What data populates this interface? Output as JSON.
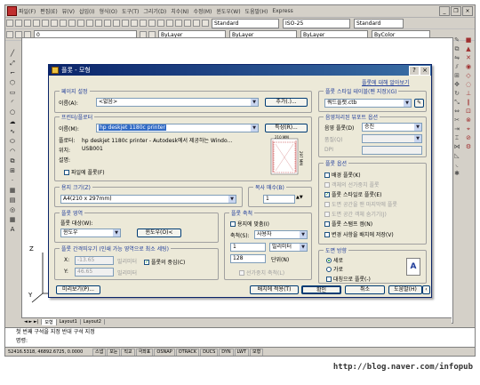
{
  "menubar": {
    "items": [
      "파일(F)",
      "편집(E)",
      "뷰(V)",
      "삽입(I)",
      "형식(O)",
      "도구(T)",
      "그리기(D)",
      "치수(N)",
      "수정(M)",
      "윈도우(W)",
      "도움말(H)",
      "Express"
    ]
  },
  "toolbar": {
    "textstyle": "Standard",
    "dimstyle": "ISO-25",
    "tablestyle": "Standard",
    "layer": "0",
    "color": "ByLayer",
    "linetype": "ByLayer",
    "lineweight": "ByLayer",
    "plotstyle": "ByColor"
  },
  "dialog": {
    "title": "플롯 - 모형",
    "help_link": "플롯에 대해 알아보기",
    "page_setup": {
      "label": "페이지 설정",
      "name_label": "이름(A):",
      "name_value": "<없음>",
      "add_button": "추가(.)..."
    },
    "printer": {
      "label": "프린터/플로터",
      "name_label": "이름(M):",
      "name_value": "hp deskjet 1180c printer",
      "properties_button": "특성(R)...",
      "plotter_label": "플로터:",
      "plotter_value": "hp deskjet 1180c printer - Autodesk에서 제공하는 Windo...",
      "where_label": "위치:",
      "where_value": "USB001",
      "desc_label": "설명:",
      "plot_to_file": "파일에 플롯(F)",
      "preview_dim_h": "210 MM",
      "preview_dim_v": "297 MM"
    },
    "paper_size": {
      "label": "용지 크기(Z)",
      "value": "A4(210 x 297mm)"
    },
    "copies": {
      "label": "복사 매수(B)",
      "value": "1"
    },
    "plot_area": {
      "label": "플롯 영역",
      "what_label": "플롯 대상(W):",
      "what_value": "윈도우",
      "window_button": "윈도우(O)<"
    },
    "plot_offset": {
      "label": "플롯 간격띄우기 (인쇄 가능 영역으로 최소 세팅)",
      "x_label": "X:",
      "x_value": "-13.65",
      "x_unit": "밀리미터",
      "y_label": "Y:",
      "y_value": "46.65",
      "y_unit": "밀리미터",
      "center": "플롯의 중심(C)"
    },
    "plot_scale": {
      "label": "플롯 축척",
      "fit": "용지에 맞춤(I)",
      "scale_label": "축척(S):",
      "scale_value": "사용자",
      "num_value": "1",
      "num_unit": "밀리미터",
      "den_value": "128",
      "den_unit": "단위(N)",
      "lineweights": "선가중치 축척(L)"
    },
    "plot_style_table": {
      "label": "플롯 스타일 테이블(펜 지정)(G)",
      "value": "쿼드플랫.ctb"
    },
    "shaded_viewport": {
      "label": "음영처리된 뷰포트 옵션",
      "shade_label": "음영 플롯(D)",
      "shade_value": "승진",
      "quality_label": "품질(Q)",
      "quality_value": "",
      "dpi_label": "DPI",
      "dpi_value": ""
    },
    "plot_options": {
      "label": "플롯 옵션",
      "items": [
        {
          "label": "배경 플롯(K)",
          "checked": false,
          "disabled": false
        },
        {
          "label": "객체의 선가중치 플롯",
          "checked": false,
          "disabled": true
        },
        {
          "label": "플롯 스타일로 플롯(E)",
          "checked": true,
          "disabled": false
        },
        {
          "label": "도면 공간을 맨 마지막에 플롯",
          "checked": false,
          "disabled": true
        },
        {
          "label": "도면 공간 객체 숨기기(J)",
          "checked": false,
          "disabled": true
        },
        {
          "label": "플롯 스탬프 켬(N)",
          "checked": false,
          "disabled": false
        },
        {
          "label": "변경 사항을 배치에 저장(V)",
          "checked": false,
          "disabled": false
        }
      ]
    },
    "orientation": {
      "label": "도면 방향",
      "portrait": "세로",
      "landscape": "가로",
      "upside_down": "대칭으로 플롯(-)"
    },
    "buttons": {
      "preview": "미리보기(P)...",
      "apply": "배치에 적용(T)",
      "ok": "확인",
      "cancel": "취소",
      "help": "도움말(H)"
    }
  },
  "tabs": [
    "모형",
    "Layout1",
    "Layout2"
  ],
  "command_lines": [
    "첫 번째 구석을 지정  반대 구석 지정",
    "명령:"
  ],
  "status": {
    "coords": "52416.5318, 46892.6725, 0.0000",
    "toggles": [
      "스냅",
      "모눈",
      "직교",
      "극좌표",
      "OSNAP",
      "OTRACK",
      "DUCS",
      "DYN",
      "LWT",
      "모형"
    ]
  },
  "ucs": {
    "y": "Y",
    "z": "Z",
    "x": "X"
  },
  "watermark": "http://blog.naver.com/infopub"
}
